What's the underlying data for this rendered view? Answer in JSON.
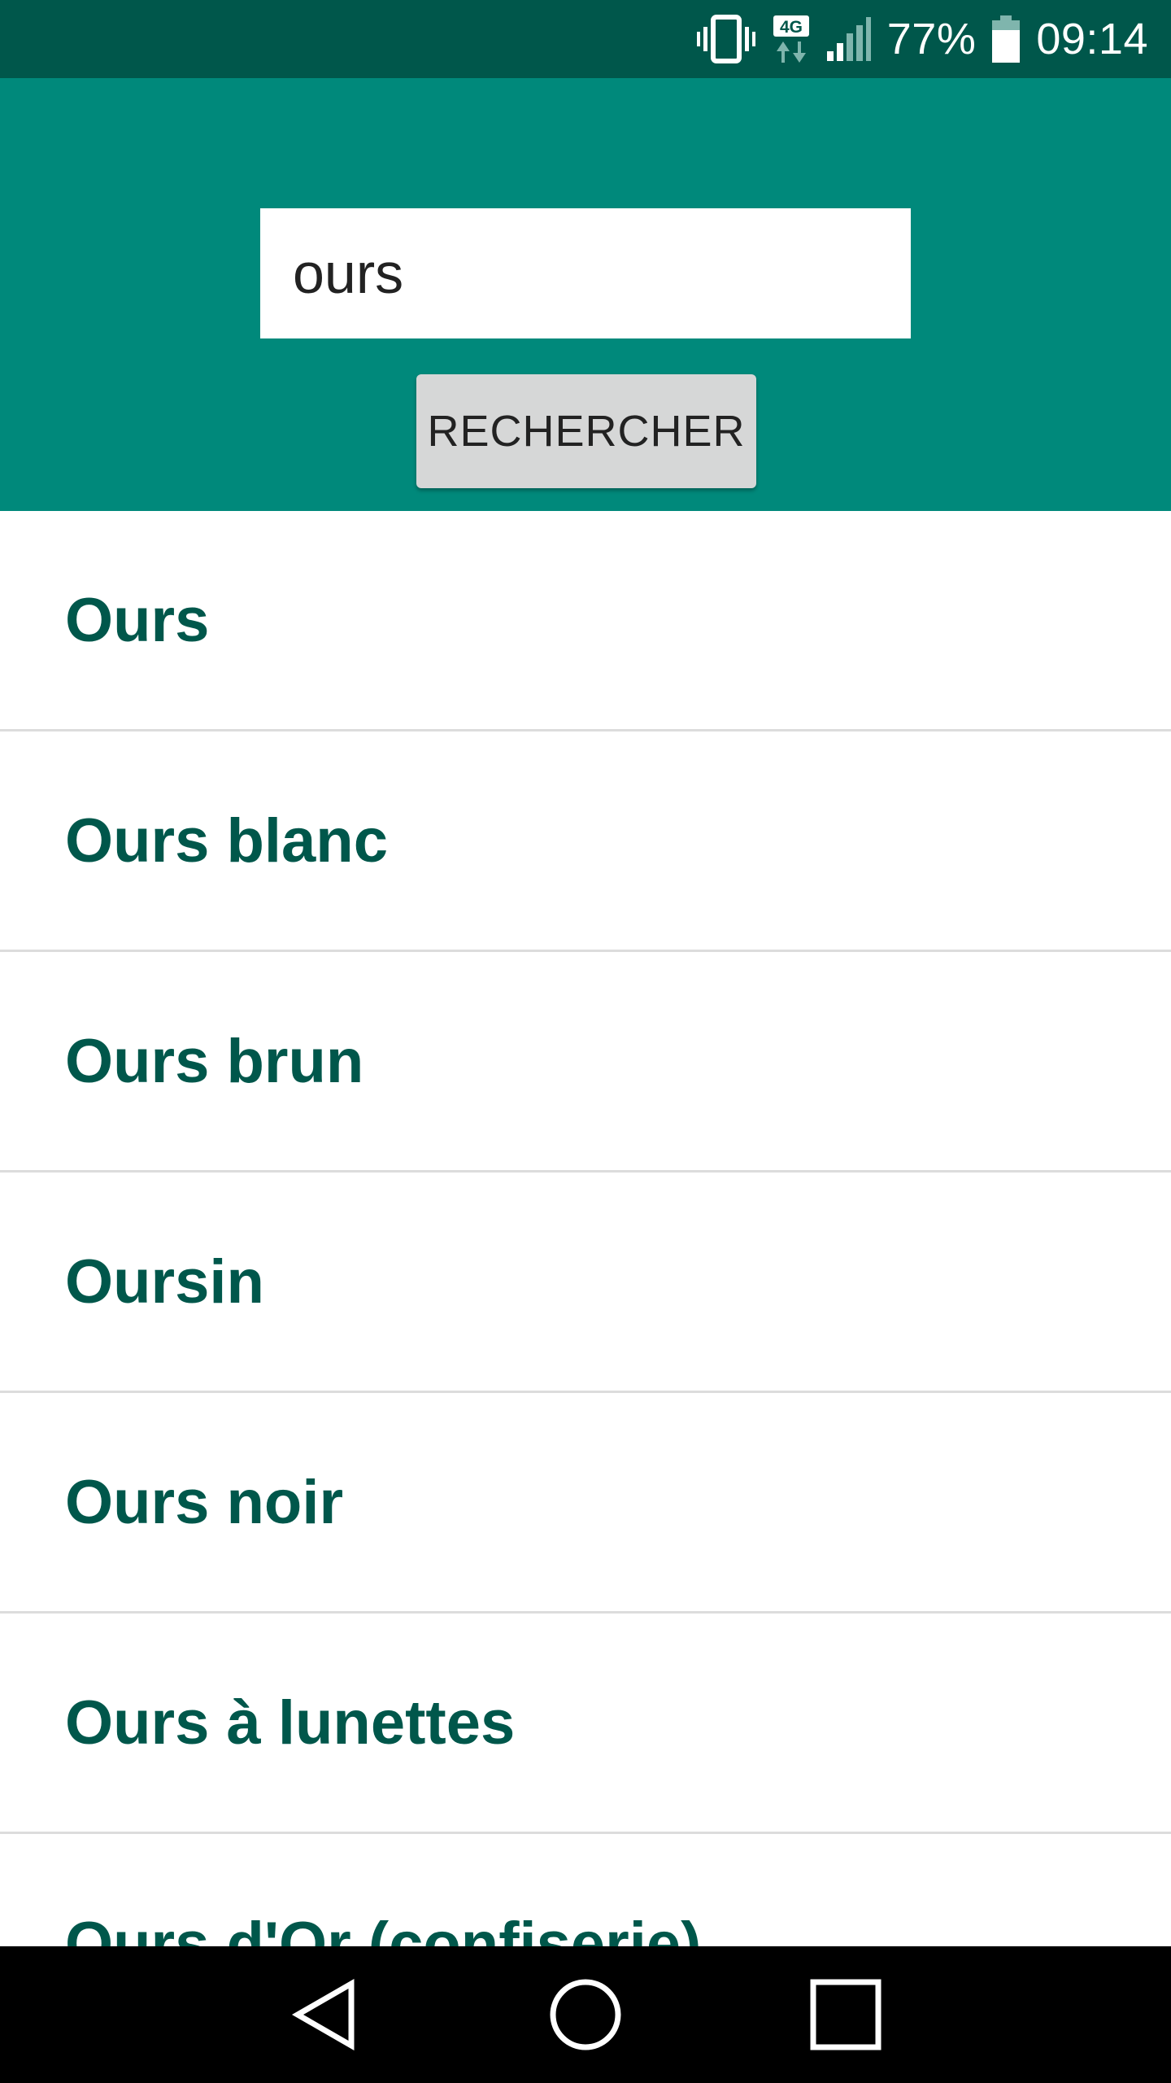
{
  "status_bar": {
    "network_label": "4G",
    "battery_percent": "77%",
    "time": "09:14"
  },
  "search": {
    "value": "ours",
    "button_label": "RECHERCHER"
  },
  "results": [
    {
      "label": "Ours"
    },
    {
      "label": "Ours blanc"
    },
    {
      "label": "Ours brun"
    },
    {
      "label": "Oursin"
    },
    {
      "label": "Ours noir"
    },
    {
      "label": "Ours à lunettes"
    },
    {
      "label": "Ours d'Or (confiserie)"
    }
  ],
  "colors": {
    "status_bar": "#00574b",
    "header": "#00897b",
    "result_text": "#00574b",
    "button": "#d6d7d7"
  },
  "icons": {
    "vibrate": "vibrate-icon",
    "network": "network-4g-icon",
    "signal": "signal-icon",
    "battery": "battery-icon",
    "back": "back-icon",
    "home": "home-icon",
    "recents": "recents-icon"
  }
}
